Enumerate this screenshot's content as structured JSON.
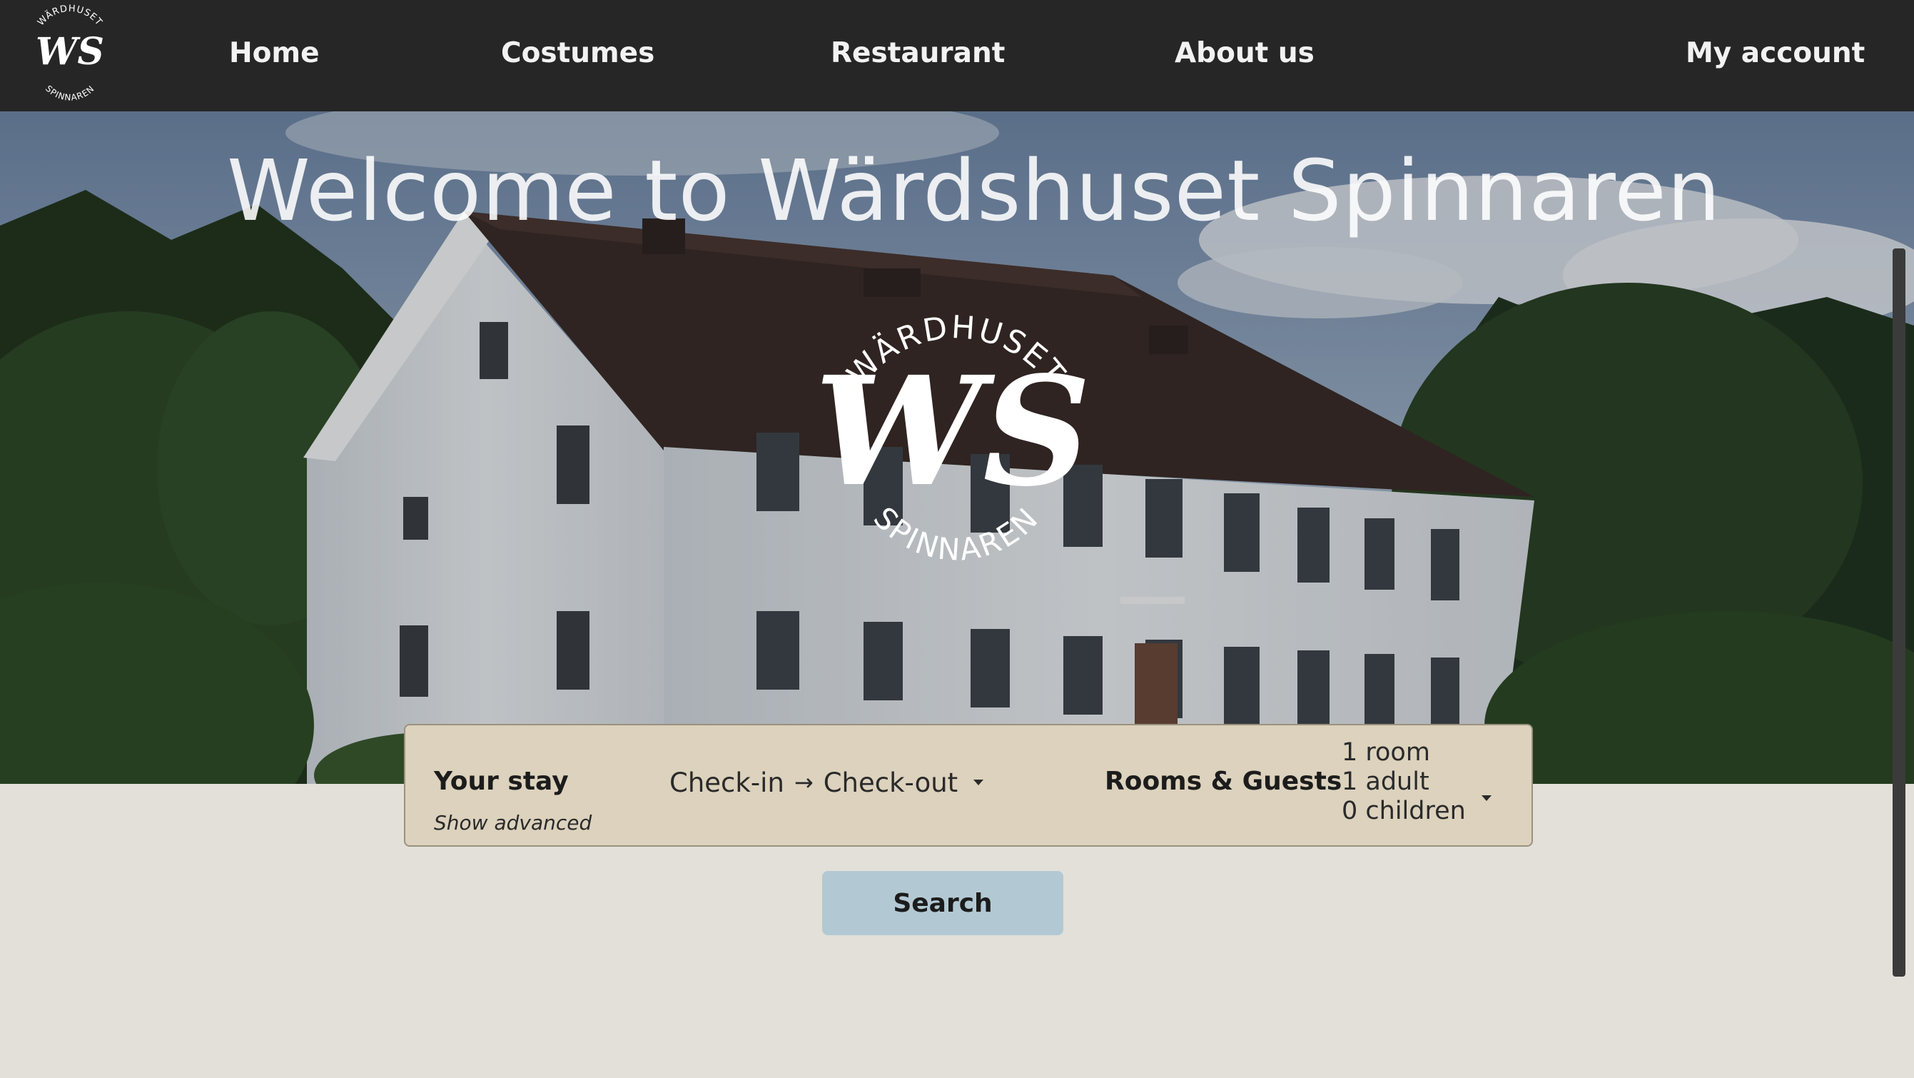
{
  "brand": {
    "logo_top_text": "WÄRDHUSET",
    "logo_monogram": "WS",
    "logo_bottom_text": "SPINNAREN"
  },
  "nav": {
    "home": "Home",
    "costumes": "Costumes",
    "restaurant": "Restaurant",
    "about": "About us",
    "account": "My account"
  },
  "hero": {
    "title": "Welcome to Wärdshuset Spinnaren"
  },
  "booking": {
    "stay_label": "Your stay",
    "advanced_link": "Show advanced",
    "check_in": "Check-in",
    "arrow": "→",
    "check_out": "Check-out",
    "guests_label": "Rooms & Guests",
    "rooms": "1 room",
    "adults": "1 adult",
    "children": "0 children"
  },
  "search": {
    "label": "Search"
  },
  "colors": {
    "nav_background": "#262626",
    "page_background": "#e3e0d9",
    "booking_background": "#dcd2bd",
    "search_button": "#b2c9d3"
  }
}
